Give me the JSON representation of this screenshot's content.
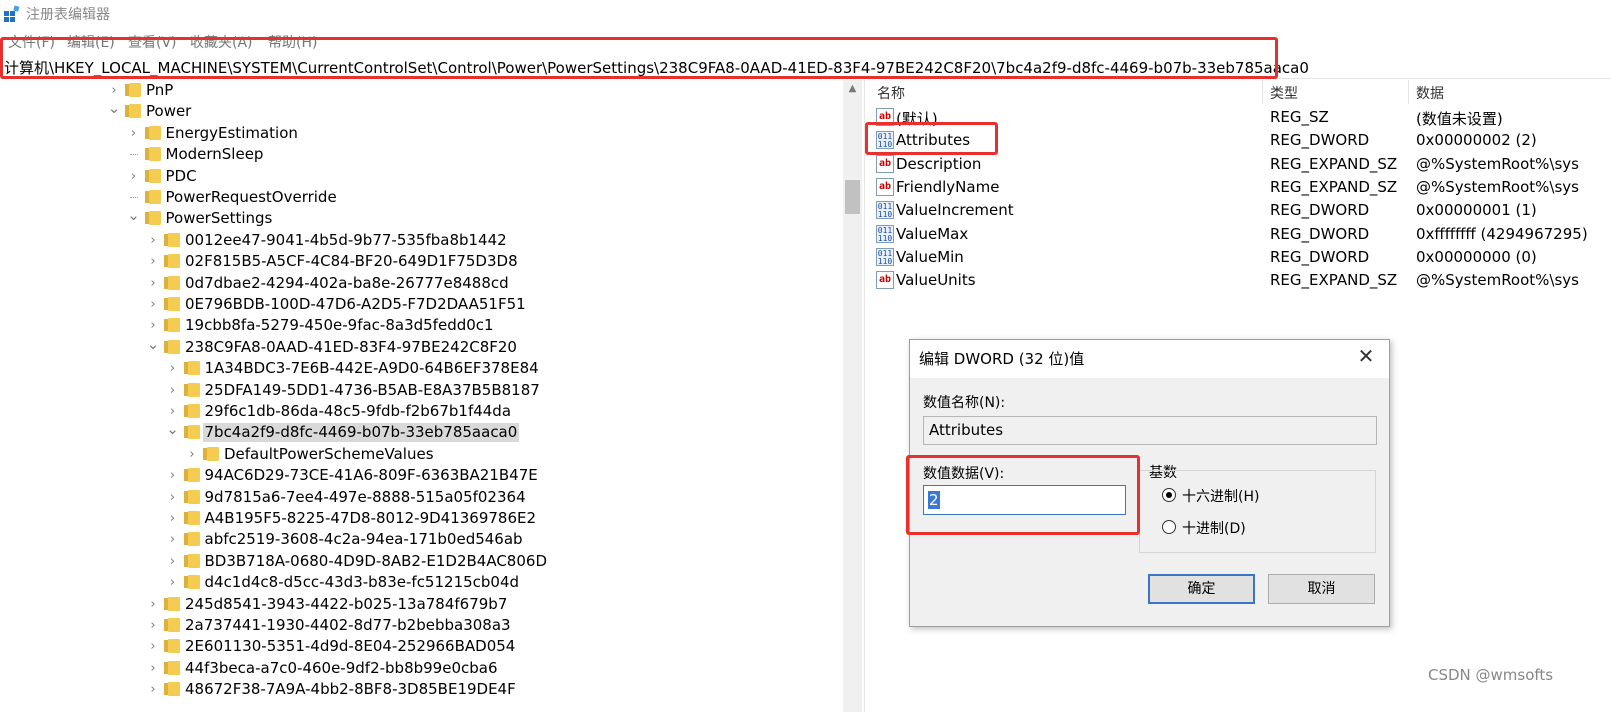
{
  "window": {
    "title": "注册表编辑器",
    "icon": "registry-editor-icon"
  },
  "menu": [
    "文件(F)",
    "编辑(E)",
    "查看(V)",
    "收藏夹(A)",
    "帮助(H)"
  ],
  "address": "计算机\\HKEY_LOCAL_MACHINE\\SYSTEM\\CurrentControlSet\\Control\\Power\\PowerSettings\\238C9FA8-0AAD-41ED-83F4-97BE242C8F20\\7bc4a2f9-d8fc-4469-b07b-33eb785aaca0",
  "tree": [
    {
      "label": "PnP",
      "level": 0,
      "expander": "collapsed"
    },
    {
      "label": "Power",
      "level": 0,
      "expander": "expanded"
    },
    {
      "label": "EnergyEstimation",
      "level": 1,
      "expander": "collapsed"
    },
    {
      "label": "ModernSleep",
      "level": 1,
      "expander": "none"
    },
    {
      "label": "PDC",
      "level": 1,
      "expander": "collapsed"
    },
    {
      "label": "PowerRequestOverride",
      "level": 1,
      "expander": "none"
    },
    {
      "label": "PowerSettings",
      "level": 1,
      "expander": "expanded"
    },
    {
      "label": "0012ee47-9041-4b5d-9b77-535fba8b1442",
      "level": 2,
      "expander": "collapsed"
    },
    {
      "label": "02F815B5-A5CF-4C84-BF20-649D1F75D3D8",
      "level": 2,
      "expander": "collapsed"
    },
    {
      "label": "0d7dbae2-4294-402a-ba8e-26777e8488cd",
      "level": 2,
      "expander": "collapsed"
    },
    {
      "label": "0E796BDB-100D-47D6-A2D5-F7D2DAA51F51",
      "level": 2,
      "expander": "collapsed"
    },
    {
      "label": "19cbb8fa-5279-450e-9fac-8a3d5fedd0c1",
      "level": 2,
      "expander": "collapsed"
    },
    {
      "label": "238C9FA8-0AAD-41ED-83F4-97BE242C8F20",
      "level": 2,
      "expander": "expanded"
    },
    {
      "label": "1A34BDC3-7E6B-442E-A9D0-64B6EF378E84",
      "level": 3,
      "expander": "collapsed"
    },
    {
      "label": "25DFA149-5DD1-4736-B5AB-E8A37B5B8187",
      "level": 3,
      "expander": "collapsed"
    },
    {
      "label": "29f6c1db-86da-48c5-9fdb-f2b67b1f44da",
      "level": 3,
      "expander": "collapsed"
    },
    {
      "label": "7bc4a2f9-d8fc-4469-b07b-33eb785aaca0",
      "level": 3,
      "expander": "expanded",
      "selected": true
    },
    {
      "label": "DefaultPowerSchemeValues",
      "level": 4,
      "expander": "collapsed"
    },
    {
      "label": "94AC6D29-73CE-41A6-809F-6363BA21B47E",
      "level": 3,
      "expander": "collapsed"
    },
    {
      "label": "9d7815a6-7ee4-497e-8888-515a05f02364",
      "level": 3,
      "expander": "collapsed"
    },
    {
      "label": "A4B195F5-8225-47D8-8012-9D41369786E2",
      "level": 3,
      "expander": "collapsed"
    },
    {
      "label": "abfc2519-3608-4c2a-94ea-171b0ed546ab",
      "level": 3,
      "expander": "collapsed"
    },
    {
      "label": "BD3B718A-0680-4D9D-8AB2-E1D2B4AC806D",
      "level": 3,
      "expander": "collapsed"
    },
    {
      "label": "d4c1d4c8-d5cc-43d3-b83e-fc51215cb04d",
      "level": 3,
      "expander": "collapsed"
    },
    {
      "label": "245d8541-3943-4422-b025-13a784f679b7",
      "level": 2,
      "expander": "collapsed"
    },
    {
      "label": "2a737441-1930-4402-8d77-b2bebba308a3",
      "level": 2,
      "expander": "collapsed"
    },
    {
      "label": "2E601130-5351-4d9d-8E04-252966BAD054",
      "level": 2,
      "expander": "collapsed"
    },
    {
      "label": "44f3beca-a7c0-460e-9df2-bb8b99e0cba6",
      "level": 2,
      "expander": "collapsed"
    },
    {
      "label": "48672F38-7A9A-4bb2-8BF8-3D85BE19DE4F",
      "level": 2,
      "expander": "collapsed"
    }
  ],
  "values_header": {
    "name": "名称",
    "type": "类型",
    "data": "数据"
  },
  "values": [
    {
      "name": "(默认)",
      "type": "REG_SZ",
      "data": "(数值未设置)",
      "kind": "sz"
    },
    {
      "name": "Attributes",
      "type": "REG_DWORD",
      "data": "0x00000002 (2)",
      "kind": "dword"
    },
    {
      "name": "Description",
      "type": "REG_EXPAND_SZ",
      "data": "@%SystemRoot%\\sys",
      "kind": "sz"
    },
    {
      "name": "FriendlyName",
      "type": "REG_EXPAND_SZ",
      "data": "@%SystemRoot%\\sys",
      "kind": "sz"
    },
    {
      "name": "ValueIncrement",
      "type": "REG_DWORD",
      "data": "0x00000001 (1)",
      "kind": "dword"
    },
    {
      "name": "ValueMax",
      "type": "REG_DWORD",
      "data": "0xffffffff (4294967295)",
      "kind": "dword"
    },
    {
      "name": "ValueMin",
      "type": "REG_DWORD",
      "data": "0x00000000 (0)",
      "kind": "dword"
    },
    {
      "name": "ValueUnits",
      "type": "REG_EXPAND_SZ",
      "data": "@%SystemRoot%\\sys",
      "kind": "sz"
    }
  ],
  "dialog": {
    "title": "编辑 DWORD (32 位)值",
    "name_label": "数值名称(N):",
    "name_value": "Attributes",
    "data_label": "数值数据(V):",
    "data_value": "2",
    "base_label": "基数",
    "hex_label": "十六进制(H)",
    "dec_label": "十进制(D)",
    "base_selected": "hex",
    "ok_label": "确定",
    "cancel_label": "取消"
  },
  "watermark": "CSDN @wmsofts",
  "colors": {
    "highlight": "#e8302f",
    "folder": "#f4cc52",
    "selection_gray": "#d9d9d9",
    "input_focus": "#3a76c4"
  }
}
